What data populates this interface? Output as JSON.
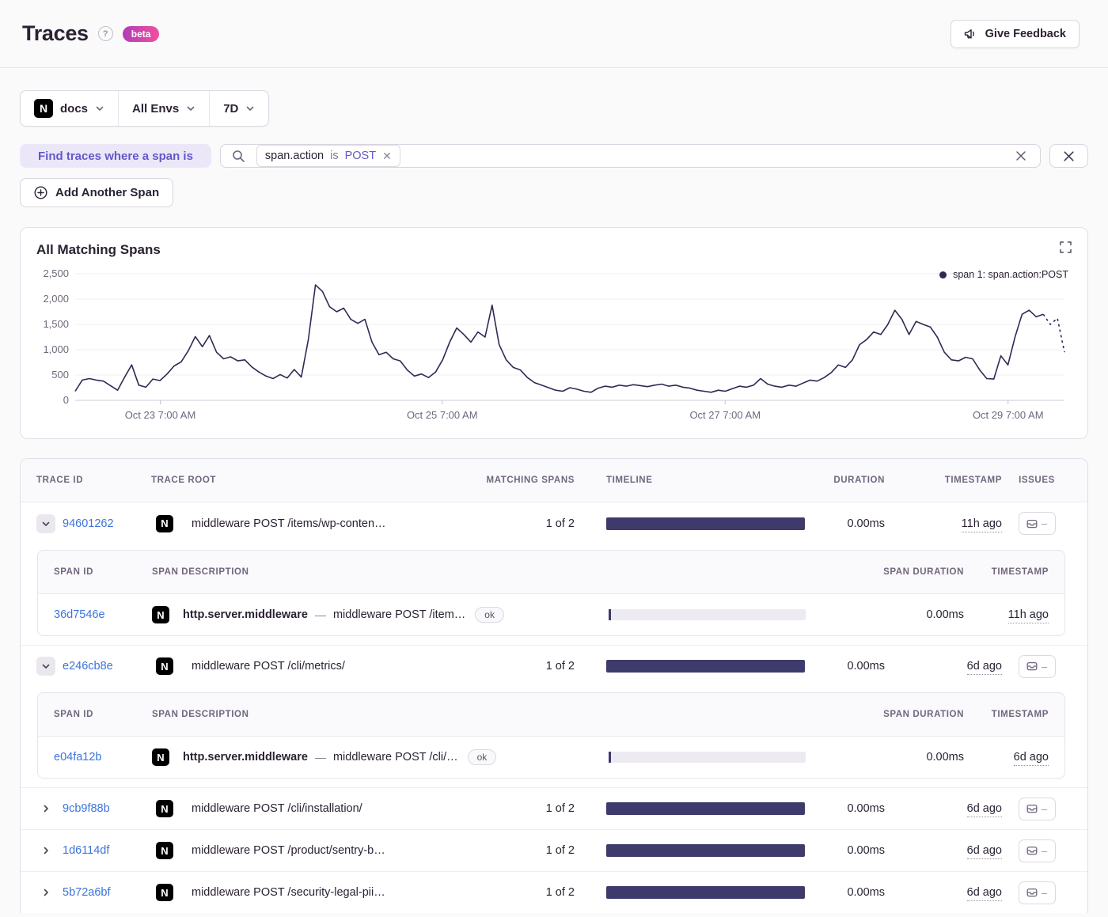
{
  "page": {
    "title": "Traces",
    "beta_label": "beta"
  },
  "header": {
    "feedback_label": "Give Feedback"
  },
  "filters": {
    "project": "docs",
    "environment": "All Envs",
    "date_range": "7D"
  },
  "span_query": {
    "label": "Find traces where a span is",
    "token": {
      "key": "span.action",
      "op": "is",
      "value": "POST"
    },
    "add_button": "Add Another Span"
  },
  "chart": {
    "title": "All Matching Spans",
    "legend": "span 1: span.action:POST"
  },
  "chart_data": {
    "type": "line",
    "title": "All Matching Spans",
    "series_name": "span 1: span.action:POST",
    "ylim": [
      0,
      2500
    ],
    "y_ticks": [
      0,
      500,
      1000,
      1500,
      2000,
      2500
    ],
    "x_ticks": [
      {
        "pos": 0.086,
        "label": "Oct 23 7:00 AM"
      },
      {
        "pos": 0.371,
        "label": "Oct 25 7:00 AM"
      },
      {
        "pos": 0.657,
        "label": "Oct 27 7:00 AM"
      },
      {
        "pos": 0.943,
        "label": "Oct 29 7:00 AM"
      }
    ],
    "grid": true,
    "legend_position": "top-right",
    "line_color": "#2e2a55",
    "dashed_tail_points": 4,
    "values": [
      180,
      400,
      430,
      400,
      380,
      290,
      200,
      460,
      700,
      300,
      260,
      420,
      390,
      520,
      680,
      760,
      980,
      1260,
      1060,
      1280,
      950,
      820,
      860,
      780,
      800,
      660,
      560,
      480,
      430,
      510,
      440,
      610,
      460,
      1200,
      2280,
      2150,
      1850,
      1750,
      1820,
      1600,
      1520,
      1600,
      1150,
      900,
      950,
      820,
      780,
      600,
      480,
      520,
      450,
      560,
      800,
      1150,
      1430,
      1300,
      1150,
      1350,
      1250,
      1880,
      1100,
      800,
      650,
      600,
      450,
      350,
      300,
      250,
      200,
      180,
      250,
      220,
      180,
      160,
      240,
      280,
      260,
      300,
      280,
      310,
      290,
      270,
      300,
      320,
      280,
      300,
      260,
      240,
      200,
      180,
      160,
      200,
      180,
      230,
      280,
      260,
      300,
      430,
      320,
      280,
      260,
      300,
      280,
      340,
      400,
      380,
      450,
      550,
      700,
      650,
      800,
      1100,
      1200,
      1350,
      1300,
      1500,
      1780,
      1600,
      1300,
      1560,
      1500,
      1450,
      1250,
      950,
      800,
      780,
      850,
      820,
      600,
      430,
      420,
      880,
      700,
      1250,
      1700,
      1780,
      1650,
      1700,
      1500,
      1620,
      950
    ]
  },
  "colors": {
    "accent_purple": "#6358c9",
    "link_blue": "#3c74dd",
    "chart_line": "#2e2a55",
    "timeline_bar": "#3e3a6b",
    "beta_gradient_from": "#b23bb8",
    "beta_gradient_to": "#f0509e"
  },
  "table": {
    "headers": {
      "trace_id": "TRACE ID",
      "trace_root": "TRACE ROOT",
      "matching": "MATCHING SPANS",
      "timeline": "TIMELINE",
      "duration": "DURATION",
      "timestamp": "TIMESTAMP",
      "issues": "ISSUES"
    },
    "span_headers": {
      "id": "SPAN ID",
      "desc": "SPAN DESCRIPTION",
      "duration": "SPAN DURATION",
      "timestamp": "TIMESTAMP"
    },
    "desc_separator": "—",
    "issues_dash": "–",
    "rows": [
      {
        "id": "94601262",
        "expanded": true,
        "root": "middleware POST /items/wp-conten…",
        "matching": "1 of 2",
        "duration": "0.00ms",
        "timestamp": "11h ago",
        "spans": [
          {
            "id": "36d7546e",
            "op": "http.server.middleware",
            "desc": "middleware POST /item…",
            "status": "ok",
            "duration": "0.00ms",
            "timestamp": "11h ago"
          }
        ]
      },
      {
        "id": "e246cb8e",
        "expanded": true,
        "root": "middleware POST /cli/metrics/",
        "matching": "1 of 2",
        "duration": "0.00ms",
        "timestamp": "6d ago",
        "spans": [
          {
            "id": "e04fa12b",
            "op": "http.server.middleware",
            "desc": "middleware POST /cli/…",
            "status": "ok",
            "duration": "0.00ms",
            "timestamp": "6d ago"
          }
        ]
      },
      {
        "id": "9cb9f88b",
        "expanded": false,
        "root": "middleware POST /cli/installation/",
        "matching": "1 of 2",
        "duration": "0.00ms",
        "timestamp": "6d ago",
        "spans": []
      },
      {
        "id": "1d6114df",
        "expanded": false,
        "root": "middleware POST /product/sentry-b…",
        "matching": "1 of 2",
        "duration": "0.00ms",
        "timestamp": "6d ago",
        "spans": []
      },
      {
        "id": "5b72a6bf",
        "expanded": false,
        "root": "middleware POST /security-legal-pii…",
        "matching": "1 of 2",
        "duration": "0.00ms",
        "timestamp": "6d ago",
        "spans": []
      }
    ]
  }
}
